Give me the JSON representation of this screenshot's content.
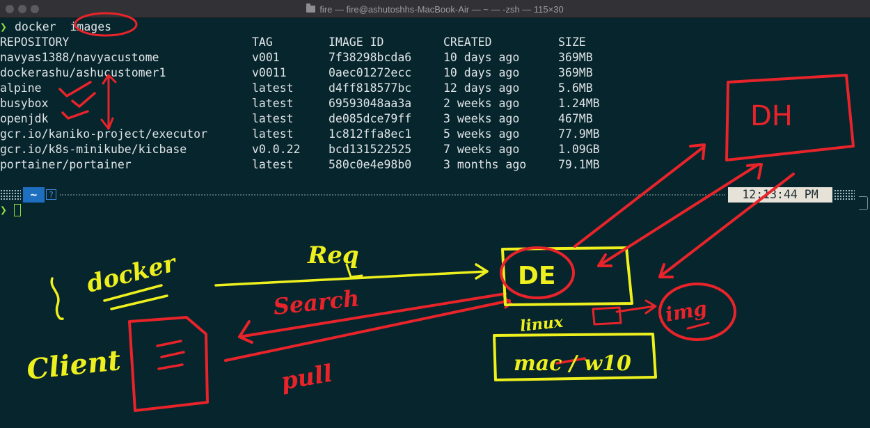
{
  "window": {
    "title": "fire — fire@ashutoshhs-MacBook-Air — ~ — -zsh — 115×30"
  },
  "terminal": {
    "prompt_symbol": "❯",
    "command": "docker  images",
    "headers": [
      "REPOSITORY",
      "TAG",
      "IMAGE ID",
      "CREATED",
      "SIZE"
    ],
    "rows": [
      [
        "navyas1388/navyacustome",
        "v001",
        "7f38298bcda6",
        "10 days ago",
        "369MB"
      ],
      [
        "dockerashu/ashucustomer1",
        "v0011",
        "0aec01272ecc",
        "10 days ago",
        "369MB"
      ],
      [
        "alpine",
        "latest",
        "d4ff818577bc",
        "12 days ago",
        "5.6MB"
      ],
      [
        "busybox",
        "latest",
        "69593048aa3a",
        "2 weeks ago",
        "1.24MB"
      ],
      [
        "openjdk",
        "latest",
        "de085dce79ff",
        "3 weeks ago",
        "467MB"
      ],
      [
        "gcr.io/kaniko-project/executor",
        "latest",
        "1c812ffa8ec1",
        "5 weeks ago",
        "77.9MB"
      ],
      [
        "gcr.io/k8s-minikube/kicbase",
        "v0.0.22",
        "bcd131522525",
        "7 weeks ago",
        "1.09GB"
      ],
      [
        "portainer/portainer",
        "latest",
        "580c0e4e98b0",
        "3 months ago",
        "79.1MB"
      ]
    ],
    "statusbar": {
      "dir": "~",
      "help": "?",
      "time": "12:13:44 PM"
    }
  },
  "annotations": {
    "colors": {
      "red": "#e8242a",
      "yellow": "#eef01e"
    },
    "labels": {
      "docker": "docker",
      "client": "Client",
      "req": "Req",
      "search": "Search",
      "pull": "pull",
      "de": "DE",
      "dh": "DH",
      "linux": "linux",
      "img": "img",
      "host": "mac / w10"
    }
  }
}
